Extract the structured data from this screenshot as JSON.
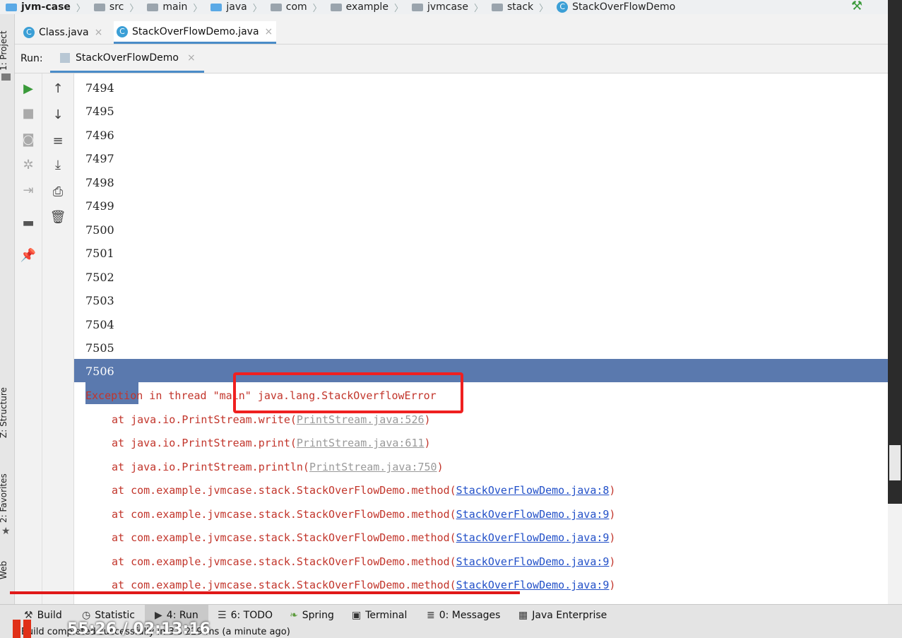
{
  "breadcrumb": [
    "jvm-case",
    "src",
    "main",
    "java",
    "com",
    "example",
    "jvmcase",
    "stack",
    "StackOverFlowDemo"
  ],
  "editor_tabs": [
    "Class.java",
    "StackOverFlowDemo.java"
  ],
  "run": {
    "label": "Run:",
    "tab": "StackOverFlowDemo"
  },
  "output_numbers": [
    "7494",
    "7495",
    "7496",
    "7497",
    "7498",
    "7499",
    "7500",
    "7501",
    "7502",
    "7503",
    "7504",
    "7505",
    "7506"
  ],
  "exception": "Exception in thread \"main\" java.lang.StackOverflowError",
  "stack": [
    {
      "at": "at java.io.PrintStream.write(",
      "link": "PrintStream.java:526",
      "end": ")",
      "style": "grey"
    },
    {
      "at": "at java.io.PrintStream.print(",
      "link": "PrintStream.java:611",
      "end": ")",
      "style": "grey"
    },
    {
      "at": "at java.io.PrintStream.println(",
      "link": "PrintStream.java:750",
      "end": ")",
      "style": "grey"
    },
    {
      "at": "at com.example.jvmcase.stack.StackOverFlowDemo.method(",
      "link": "StackOverFlowDemo.java:8",
      "end": ")",
      "style": "blue"
    },
    {
      "at": "at com.example.jvmcase.stack.StackOverFlowDemo.method(",
      "link": "StackOverFlowDemo.java:9",
      "end": ")",
      "style": "blue"
    },
    {
      "at": "at com.example.jvmcase.stack.StackOverFlowDemo.method(",
      "link": "StackOverFlowDemo.java:9",
      "end": ")",
      "style": "blue"
    },
    {
      "at": "at com.example.jvmcase.stack.StackOverFlowDemo.method(",
      "link": "StackOverFlowDemo.java:9",
      "end": ")",
      "style": "blue"
    },
    {
      "at": "at com.example.jvmcase.stack.StackOverFlowDemo.method(",
      "link": "StackOverFlowDemo.java:9",
      "end": ")",
      "style": "blue"
    }
  ],
  "left_strip": {
    "project": "1: Project",
    "structure": "Z: Structure",
    "favorites": "2: Favorites",
    "web": "Web"
  },
  "bottom_tabs": [
    "Build",
    "Statistic",
    "4: Run",
    "6: TODO",
    "Spring",
    "Terminal",
    "0: Messages",
    "Java Enterprise"
  ],
  "status": "Build completed successfully in 3 s 229 ms (a minute ago)",
  "video_time": "55:26 / 02:13:16"
}
